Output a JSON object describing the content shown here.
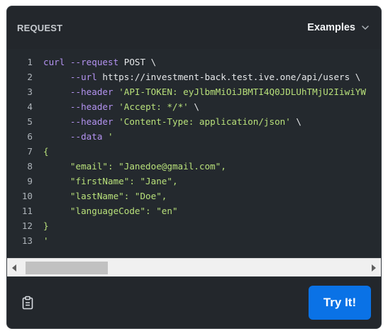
{
  "header": {
    "title": "REQUEST",
    "examples_label": "Examples"
  },
  "code": {
    "lines": [
      {
        "n": "1",
        "parts": [
          [
            "kw",
            "curl"
          ],
          [
            "plain",
            " "
          ],
          [
            "opt",
            "--request"
          ],
          [
            "plain",
            " POST \\"
          ]
        ]
      },
      {
        "n": "2",
        "parts": [
          [
            "plain",
            "     "
          ],
          [
            "opt",
            "--url"
          ],
          [
            "plain",
            " https://investment-back.test.ive.one/api/users \\"
          ]
        ]
      },
      {
        "n": "3",
        "parts": [
          [
            "plain",
            "     "
          ],
          [
            "opt",
            "--header"
          ],
          [
            "plain",
            " "
          ],
          [
            "green",
            "'API-TOKEN: eyJlbmMiOiJBMTI4Q0JDLUhTMjU2IiwiYW"
          ]
        ]
      },
      {
        "n": "4",
        "parts": [
          [
            "plain",
            "     "
          ],
          [
            "opt",
            "--header"
          ],
          [
            "plain",
            " "
          ],
          [
            "green",
            "'Accept: */*'"
          ],
          [
            "plain",
            " \\"
          ]
        ]
      },
      {
        "n": "5",
        "parts": [
          [
            "plain",
            "     "
          ],
          [
            "opt",
            "--header"
          ],
          [
            "plain",
            " "
          ],
          [
            "green",
            "'Content-Type: application/json'"
          ],
          [
            "plain",
            " \\"
          ]
        ]
      },
      {
        "n": "6",
        "parts": [
          [
            "plain",
            "     "
          ],
          [
            "opt",
            "--data"
          ],
          [
            "plain",
            " "
          ],
          [
            "green",
            "'"
          ]
        ]
      },
      {
        "n": "7",
        "parts": [
          [
            "green",
            "{"
          ]
        ]
      },
      {
        "n": "8",
        "parts": [
          [
            "green",
            "     \"email\": \"Janedoe@gmail.com\","
          ]
        ]
      },
      {
        "n": "9",
        "parts": [
          [
            "green",
            "     \"firstName\": \"Jane\","
          ]
        ]
      },
      {
        "n": "10",
        "parts": [
          [
            "green",
            "     \"lastName\": \"Doe\","
          ]
        ]
      },
      {
        "n": "11",
        "parts": [
          [
            "green",
            "     \"languageCode\": \"en\""
          ]
        ]
      },
      {
        "n": "12",
        "parts": [
          [
            "green",
            "}"
          ]
        ]
      },
      {
        "n": "13",
        "parts": [
          [
            "green",
            "'"
          ]
        ]
      }
    ]
  },
  "footer": {
    "try_label": "Try It!"
  },
  "icons": {
    "copy": "clipboard-icon",
    "examples": "chevron-down-icon"
  },
  "colors": {
    "panel_bg": "#23272c",
    "accent": "#0a72e6",
    "keyword": "#b392f0",
    "string": "#b8e07a"
  }
}
